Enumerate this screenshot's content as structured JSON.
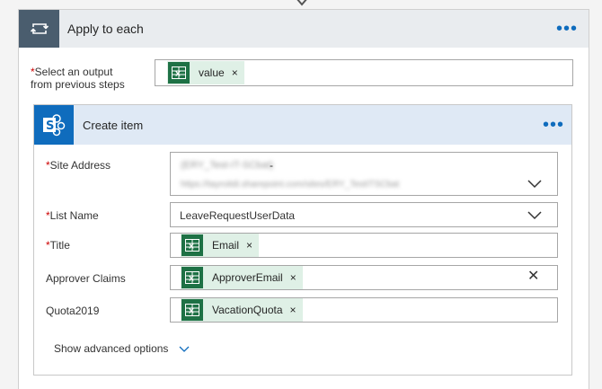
{
  "loop": {
    "title": "Apply to each",
    "more_label": "•••",
    "output_label_line1": "Select an output",
    "output_label_line2": "from previous steps",
    "output_token": "value",
    "remove_glyph": "×"
  },
  "action": {
    "title": "Create item",
    "more_label": "•••",
    "fields": {
      "site_address": {
        "label": "Site Address",
        "value_line1": "(ERY_Test-IT-SCbat)",
        "value_line2": "https://tayroitdi.sharepoint.com/sites/ERY_TestITSCbat",
        "suffix": "-"
      },
      "list_name": {
        "label": "List Name",
        "value": "LeaveRequestUserData"
      },
      "title": {
        "label": "Title",
        "token": "Email"
      },
      "approver_claims": {
        "label": "Approver Claims",
        "token": "ApproverEmail",
        "clear_glyph": "✕"
      },
      "quota": {
        "label": "Quota2019",
        "token": "VacationQuota"
      }
    },
    "advanced_label": "Show advanced options"
  },
  "required_marker": "*",
  "colors": {
    "loop_icon_bg": "#4a5d6e",
    "sharepoint_blue": "#0f6cbd",
    "excel_green": "#1e7145",
    "token_bg": "#dff0e6",
    "required_red": "#cc0000"
  },
  "icons": {
    "loop": "loop-icon",
    "sharepoint": "sharepoint-icon",
    "excel": "excel-icon",
    "chevron": "chevron-down-icon"
  }
}
